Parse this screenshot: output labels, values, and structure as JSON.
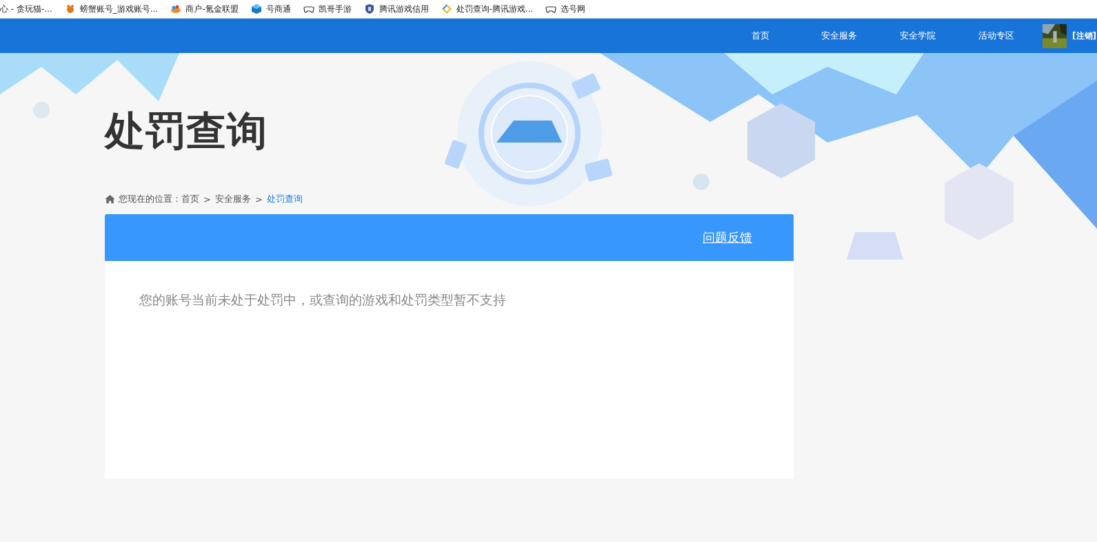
{
  "bookmarks": [
    {
      "label": "心 - 贪玩猫-..."
    },
    {
      "label": "螃蟹账号_游戏账号..."
    },
    {
      "label": "商户-氪金联盟"
    },
    {
      "label": "号商通"
    },
    {
      "label": "凯哥手游"
    },
    {
      "label": "腾讯游戏信用"
    },
    {
      "label": "处罚查询-腾讯游戏..."
    },
    {
      "label": "选号网"
    }
  ],
  "nav": {
    "items": [
      "首页",
      "安全服务",
      "安全学院",
      "活动专区"
    ],
    "logout": "[注销]"
  },
  "banner": {
    "kind": "picture",
    "title": "处罚查询"
  },
  "breadcrumb": {
    "prefix": "您现在的位置：",
    "items": [
      {
        "label": "首页",
        "current": false
      },
      {
        "label": "安全服务",
        "current": false
      },
      {
        "label": "处罚查询",
        "current": true
      }
    ],
    "separator": ">"
  },
  "card": {
    "feedback_link": "问题反馈",
    "message": "您的账号当前未处于处罚中，或查询的游戏和处罚类型暂不支持"
  }
}
